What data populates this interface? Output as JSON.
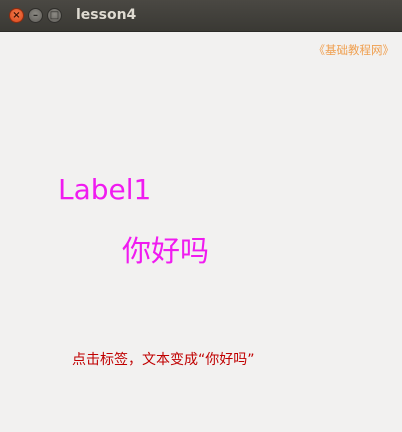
{
  "window": {
    "title": "lesson4",
    "close_glyph": "×",
    "minimize_glyph": "–",
    "maximize_glyph": "□"
  },
  "content": {
    "watermark": "《基础教程网》",
    "label1": "Label1",
    "hello_label": "你好吗",
    "hint": "点击标签，文本变成“你好吗”"
  },
  "colors": {
    "label": "#f01bf0",
    "hint": "#c00000",
    "watermark": "#f0a050",
    "titlebar": "#3c3b37"
  },
  "icons": [
    "close-icon",
    "minimize-icon",
    "maximize-icon"
  ]
}
